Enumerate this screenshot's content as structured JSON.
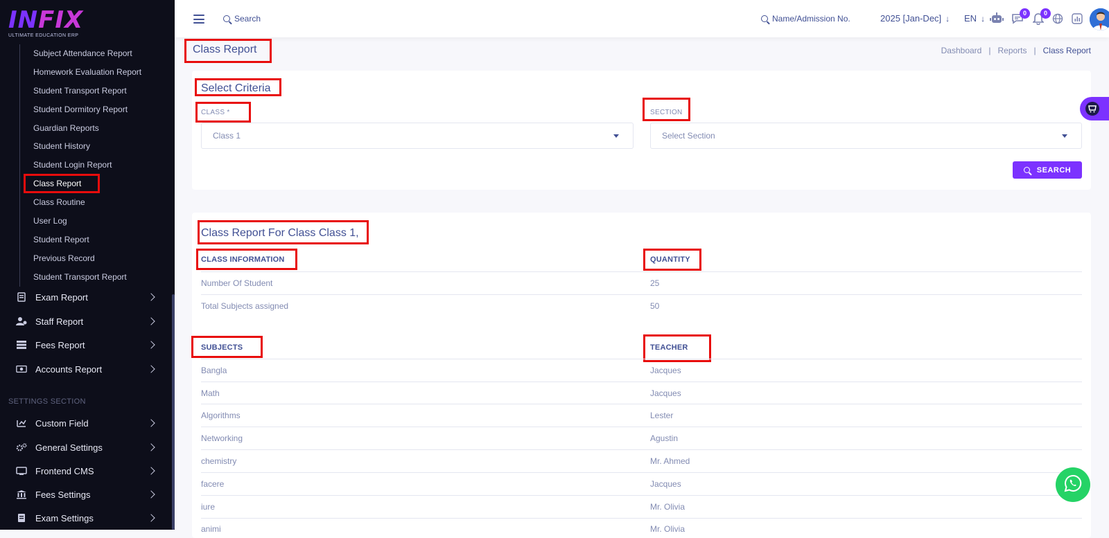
{
  "logo": {
    "text_a": "IN",
    "text_b": "FIX",
    "tagline": "ULTIMATE EDUCATION ERP"
  },
  "sidebar": {
    "sub_items": [
      {
        "label": "Subject Attendance Report"
      },
      {
        "label": "Homework Evaluation Report"
      },
      {
        "label": "Student Transport Report"
      },
      {
        "label": "Student Dormitory Report"
      },
      {
        "label": "Guardian Reports"
      },
      {
        "label": "Student History"
      },
      {
        "label": "Student Login Report"
      },
      {
        "label": "Class Report"
      },
      {
        "label": "Class Routine"
      },
      {
        "label": "User Log"
      },
      {
        "label": "Student Report"
      },
      {
        "label": "Previous Record"
      },
      {
        "label": "Student Transport Report"
      }
    ],
    "active_sub_item": "Class Report",
    "menu_items": [
      {
        "label": "Exam Report",
        "icon": "exam-icon"
      },
      {
        "label": "Staff Report",
        "icon": "staff-icon"
      },
      {
        "label": "Fees Report",
        "icon": "fees-icon"
      },
      {
        "label": "Accounts Report",
        "icon": "accounts-icon"
      }
    ],
    "settings_section_title": "SETTINGS SECTION",
    "settings_items": [
      {
        "label": "Custom Field",
        "icon": "custom-field-icon"
      },
      {
        "label": "General Settings",
        "icon": "gears-icon"
      },
      {
        "label": "Frontend CMS",
        "icon": "cms-icon"
      },
      {
        "label": "Fees Settings",
        "icon": "bank-icon"
      },
      {
        "label": "Exam Settings",
        "icon": "exam-settings-icon"
      }
    ]
  },
  "header": {
    "search_label": "Search",
    "admission_label": "Name/Admission No.",
    "year": "2025 [Jan-Dec]",
    "language": "EN",
    "chat_badge": "0",
    "notification_badge": "0"
  },
  "page": {
    "title": "Class Report",
    "breadcrumb": [
      "Dashboard",
      "Reports",
      "Class Report"
    ]
  },
  "criteria": {
    "title": "Select Criteria",
    "class_label": "CLASS *",
    "class_value": "Class 1",
    "section_label": "SECTION",
    "section_placeholder": "Select Section",
    "search_button": "SEARCH"
  },
  "report": {
    "title": "Class Report For Class Class 1,",
    "info_header": "CLASS INFORMATION",
    "quantity_header": "QUANTITY",
    "info_rows": [
      {
        "label": "Number Of Student",
        "value": "25"
      },
      {
        "label": "Total Subjects assigned",
        "value": "50"
      }
    ],
    "subjects_header": "SUBJECTS",
    "teacher_header": "TEACHER",
    "subject_rows": [
      {
        "subject": "Bangla",
        "teacher": "Jacques"
      },
      {
        "subject": "Math",
        "teacher": "Jacques"
      },
      {
        "subject": "Algorithms",
        "teacher": "Lester"
      },
      {
        "subject": "Networking",
        "teacher": "Agustin"
      },
      {
        "subject": "chemistry",
        "teacher": "Mr. Ahmed"
      },
      {
        "subject": "facere",
        "teacher": "Jacques"
      },
      {
        "subject": "iure",
        "teacher": "Mr. Olivia"
      },
      {
        "subject": "animi",
        "teacher": "Mr. Olivia"
      }
    ]
  },
  "colors": {
    "accent": "#7c32ff",
    "text": "#415094",
    "muted": "#828bb2",
    "highlight": "#e80c0c",
    "sidebar": "#0d0e1a",
    "whatsapp": "#25d366"
  }
}
